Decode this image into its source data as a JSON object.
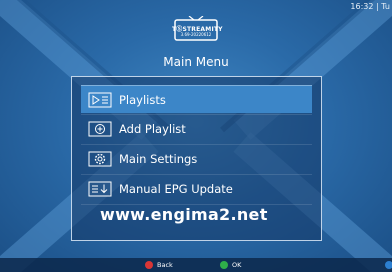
{
  "status_bar": {
    "clock": "16:32 | Tu"
  },
  "logo": {
    "name": "TⓈSTREAMITY",
    "version": "3.69-20220612"
  },
  "header": {
    "title": "Main Menu"
  },
  "menu": {
    "items": [
      {
        "label": "Playlists",
        "icon": "playlist-icon",
        "selected": true
      },
      {
        "label": "Add Playlist",
        "icon": "add-icon",
        "selected": false
      },
      {
        "label": "Main Settings",
        "icon": "gear-icon",
        "selected": false
      },
      {
        "label": "Manual EPG Update",
        "icon": "download-icon",
        "selected": false
      }
    ]
  },
  "watermark": "www.engima2.net",
  "footer": {
    "back_label": "Back",
    "ok_label": "OK",
    "back_color": "#d93636",
    "ok_color": "#2fae4a",
    "third_color": "#2c7fd0"
  },
  "colors": {
    "selection": "#3c86c8",
    "background": "#2a6aa8"
  }
}
